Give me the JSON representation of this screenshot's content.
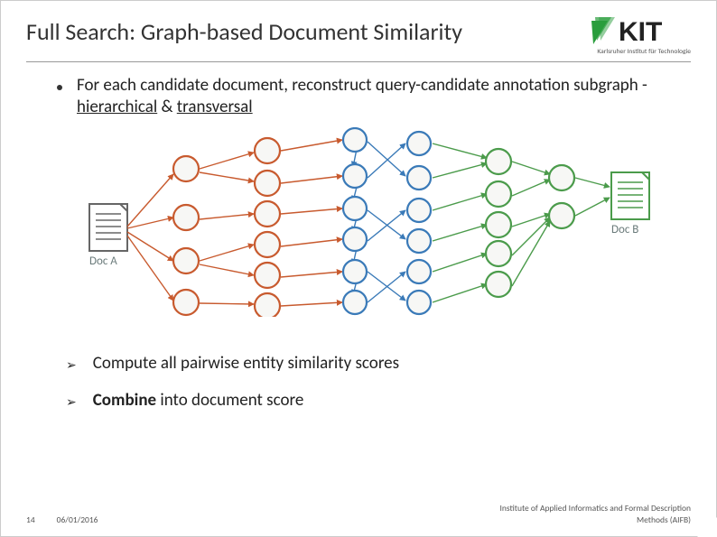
{
  "title": "Full Search: Graph-based Document Similarity",
  "logo_subtitle": "Karlsruher Institut für Technologie",
  "bullets": {
    "main_pre": "For each candidate document, reconstruct query-candidate annotation subgraph - ",
    "main_styled_1": "hierarchical",
    "main_amp": " & ",
    "main_styled_2": "transversal",
    "sub1": "Compute all pairwise entity similarity scores",
    "sub2_bold": "Combine",
    "sub2_rest": " into document score"
  },
  "graph": {
    "docA_label": "Doc A",
    "docB_label": "Doc B",
    "node_stroke_orange": "#C85A2E",
    "node_stroke_blue": "#3A7AB8",
    "node_stroke_green": "#4B9B4B",
    "node_fill": "#F7F7F5"
  },
  "footer": {
    "page_num": "14",
    "date": "06/01/2016",
    "institute_line1": "Institute of Applied Informatics and Formal Description",
    "institute_line2": "Methods (AIFB)"
  }
}
